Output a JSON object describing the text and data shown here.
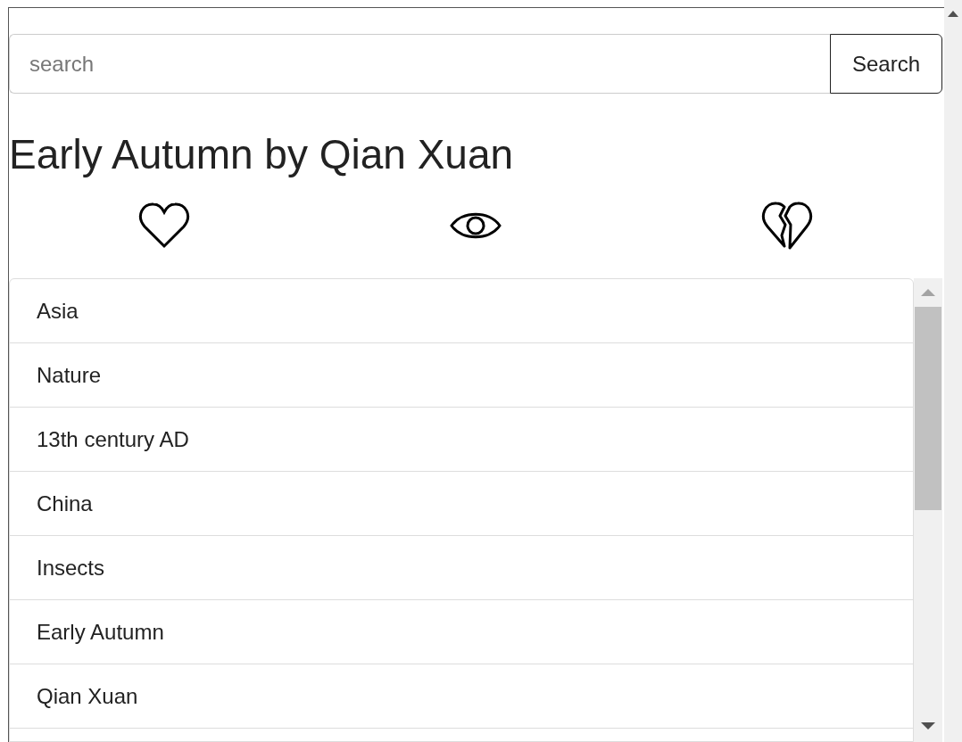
{
  "search": {
    "placeholder": "search",
    "button": "Search"
  },
  "title": "Early Autumn by Qian Xuan",
  "actions": [
    {
      "kind": "like"
    },
    {
      "kind": "view"
    },
    {
      "kind": "dislike"
    }
  ],
  "tags": [
    "Asia",
    "Nature",
    "13th century AD",
    "China",
    "Insects",
    "Early Autumn",
    "Qian Xuan"
  ]
}
